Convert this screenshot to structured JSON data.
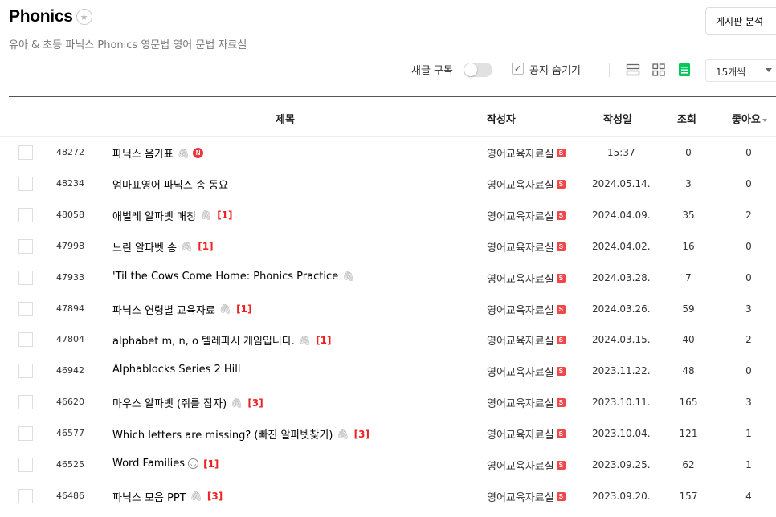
{
  "header": {
    "title": "Phonics",
    "subtitle": "유아 & 초등 파닉스 Phonics 영문법 영어 문법 자료실",
    "analysis_button": "게시판 분석"
  },
  "toolbar": {
    "subscribe_label": "새글 구독",
    "subscribe_on": false,
    "hide_notice_label": "공지 숨기기",
    "hide_notice_checked": true,
    "view_modes": [
      "list-view-icon",
      "grid-view-icon",
      "card-view-icon"
    ],
    "active_view": "card-view-icon",
    "per_page": "15개씩"
  },
  "columns": {
    "subject": "제목",
    "writer": "작성자",
    "date": "작성일",
    "views": "조회",
    "likes": "좋아요"
  },
  "colors": {
    "accent_green": "#03c75a",
    "badge_red": "#f0474b",
    "comment_red": "#e22222"
  },
  "rows": [
    {
      "no": "48272",
      "subject": "파닉스 음가표",
      "attach": true,
      "new": true,
      "comments": "",
      "writer": "영어교육자료실",
      "date": "15:37",
      "views": "0",
      "likes": "0"
    },
    {
      "no": "48234",
      "subject": "엄마표영어 파닉스 송 동요",
      "attach": false,
      "new": false,
      "comments": "",
      "writer": "영어교육자료실",
      "date": "2024.05.14.",
      "views": "3",
      "likes": "0"
    },
    {
      "no": "48058",
      "subject": "애벌레 알파벳 매칭",
      "attach": true,
      "new": false,
      "comments": "[1]",
      "writer": "영어교육자료실",
      "date": "2024.04.09.",
      "views": "35",
      "likes": "2"
    },
    {
      "no": "47998",
      "subject": "느린 알파벳 송",
      "attach": true,
      "new": false,
      "comments": "[1]",
      "writer": "영어교육자료실",
      "date": "2024.04.02.",
      "views": "16",
      "likes": "0"
    },
    {
      "no": "47933",
      "subject": "'Til the Cows Come Home: Phonics Practice",
      "attach": true,
      "new": false,
      "comments": "",
      "writer": "영어교육자료실",
      "date": "2024.03.28.",
      "views": "7",
      "likes": "0"
    },
    {
      "no": "47894",
      "subject": "파닉스 연령별 교육자료",
      "attach": true,
      "new": false,
      "comments": "[1]",
      "writer": "영어교육자료실",
      "date": "2024.03.26.",
      "views": "59",
      "likes": "3"
    },
    {
      "no": "47804",
      "subject": "alphabet m, n, o 텔레파시 게임입니다.",
      "attach": true,
      "new": false,
      "comments": "[1]",
      "writer": "영어교육자료실",
      "date": "2024.03.15.",
      "views": "40",
      "likes": "2"
    },
    {
      "no": "46942",
      "subject": "Alphablocks Series 2 Hill",
      "attach": false,
      "new": false,
      "comments": "",
      "writer": "영어교육자료실",
      "date": "2023.11.22.",
      "views": "48",
      "likes": "0"
    },
    {
      "no": "46620",
      "subject": "마우스 알파벳 (쥐를 잡자)",
      "attach": true,
      "new": false,
      "comments": "[3]",
      "writer": "영어교육자료실",
      "date": "2023.10.11.",
      "views": "165",
      "likes": "3"
    },
    {
      "no": "46577",
      "subject": "Which letters are missing? (빠진 알파벳찾기)",
      "attach": true,
      "new": false,
      "comments": "[3]",
      "writer": "영어교육자료실",
      "date": "2023.10.04.",
      "views": "121",
      "likes": "1"
    },
    {
      "no": "46525",
      "subject": "Word Families",
      "attach": false,
      "face": true,
      "new": false,
      "comments": "[1]",
      "writer": "영어교육자료실",
      "date": "2023.09.25.",
      "views": "62",
      "likes": "1"
    },
    {
      "no": "46486",
      "subject": "파닉스 모음 PPT",
      "attach": true,
      "new": false,
      "comments": "[3]",
      "writer": "영어교육자료실",
      "date": "2023.09.20.",
      "views": "157",
      "likes": "4"
    }
  ]
}
